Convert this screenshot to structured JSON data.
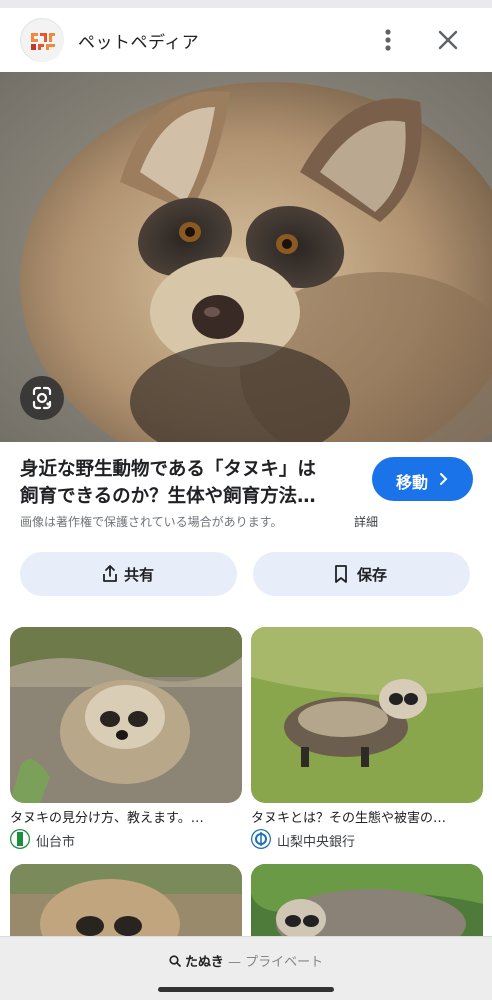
{
  "header": {
    "site_name": "ペットペディア",
    "logo_icon": "petpedia-logo",
    "more_icon": "more-vert-icon",
    "close_icon": "close-icon"
  },
  "hero": {
    "image_subject": "tanuki raccoon dog close-up",
    "lens_icon": "lens-icon"
  },
  "result": {
    "title_line1": "身近な野生動物である「タヌキ」は",
    "title_line2": "飼育できるのか？生体や飼育方法…",
    "visit_label": "移動",
    "copyright_note": "画像は著作権で保護されている場合があります。",
    "details_label": "詳細"
  },
  "actions": {
    "share_label": "共有",
    "save_label": "保存"
  },
  "related": [
    {
      "title": "タヌキの見分け方、教えます。…",
      "source": "仙台市"
    },
    {
      "title": "タヌキとは？その生態や被害の…",
      "source": "山梨中央銀行"
    },
    {
      "title": "",
      "source": ""
    },
    {
      "title": "",
      "source": ""
    }
  ],
  "bottom": {
    "query": "たぬき",
    "separator": "—",
    "mode": "プライベート"
  },
  "colors": {
    "accent": "#1a73e8",
    "chip_bg": "#e8eef9",
    "sendai_icon": "#1e8e3e",
    "yamanashi_icon": "#1f6fb5"
  }
}
